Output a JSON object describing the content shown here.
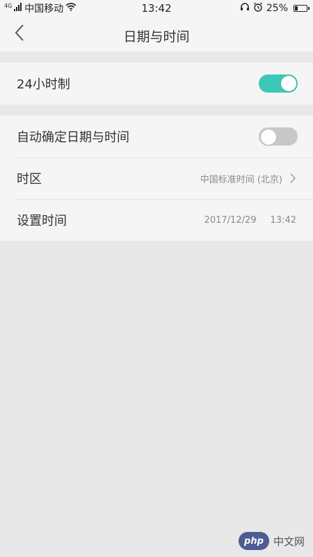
{
  "status_bar": {
    "signal_small": "4G",
    "carrier": "中国移动",
    "time": "13:42",
    "battery_percent": "25%",
    "battery_level": 0.25,
    "icons": [
      "signal-icon",
      "wifi-icon",
      "headset-icon",
      "alarm-icon",
      "battery-icon"
    ]
  },
  "header": {
    "title": "日期与时间",
    "back_icon": "chevron-left-icon"
  },
  "settings": {
    "hour24": {
      "label": "24小时制",
      "enabled": true
    },
    "auto_datetime": {
      "label": "自动确定日期与时间",
      "enabled": false
    },
    "timezone": {
      "label": "时区",
      "value": "中国标准时间 (北京)"
    },
    "set_time": {
      "label": "设置时间",
      "date": "2017/12/29",
      "time": "13:42"
    }
  },
  "watermark": {
    "badge": "php",
    "text": "中文网"
  },
  "colors": {
    "accent": "#3cc8b4",
    "toggle_off": "#c8c8c8",
    "background": "#e8e8e8",
    "surface": "#f5f5f5",
    "php_badge": "#4f5b93"
  }
}
